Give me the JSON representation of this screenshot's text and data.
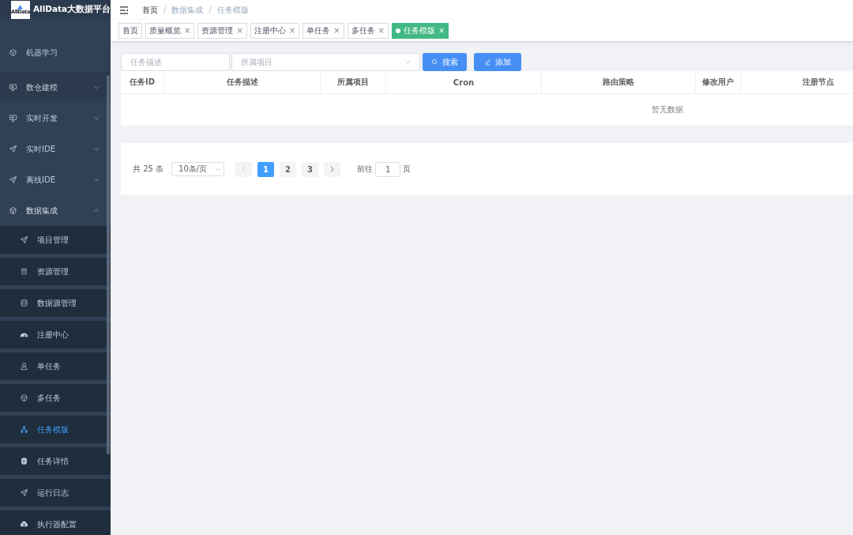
{
  "app": {
    "title": "AllData大数据平台",
    "logo": "AllData"
  },
  "sidebar": {
    "items": [
      {
        "label": "机器学习",
        "has_arrow": false,
        "expanded": false,
        "selected": false
      },
      {
        "label": "数仓建模",
        "has_arrow": true,
        "expanded": false,
        "selected": false
      },
      {
        "label": "实时开发",
        "has_arrow": true,
        "expanded": false,
        "selected": false
      },
      {
        "label": "实时IDE",
        "has_arrow": true,
        "expanded": false,
        "selected": false
      },
      {
        "label": "离线IDE",
        "has_arrow": true,
        "expanded": false,
        "selected": false
      },
      {
        "label": "数据集成",
        "has_arrow": true,
        "expanded": true,
        "selected": false,
        "children": [
          {
            "label": "项目管理",
            "selected": false
          },
          {
            "label": "资源管理",
            "selected": false
          },
          {
            "label": "数据源管理",
            "selected": false
          },
          {
            "label": "注册中心",
            "selected": false
          },
          {
            "label": "单任务",
            "selected": false
          },
          {
            "label": "多任务",
            "selected": false
          },
          {
            "label": "任务模版",
            "selected": true
          },
          {
            "label": "任务详情",
            "selected": false
          },
          {
            "label": "运行日志",
            "selected": false
          },
          {
            "label": "执行器配置",
            "selected": false
          }
        ]
      }
    ]
  },
  "breadcrumb": [
    "首页",
    "数据集成",
    "任务模版"
  ],
  "breadcrumb_separator": "/",
  "tabs": [
    {
      "label": "首页",
      "closable": false,
      "selected": false
    },
    {
      "label": "质量概览",
      "closable": true,
      "selected": false
    },
    {
      "label": "资源管理",
      "closable": true,
      "selected": false
    },
    {
      "label": "注册中心",
      "closable": true,
      "selected": false
    },
    {
      "label": "单任务",
      "closable": true,
      "selected": false
    },
    {
      "label": "多任务",
      "closable": true,
      "selected": false
    },
    {
      "label": "任务模版",
      "closable": true,
      "selected": true
    }
  ],
  "close_glyph": "×",
  "filters": {
    "description": {
      "placeholder": "任务描述"
    },
    "project": {
      "placeholder": "所属项目"
    }
  },
  "buttons": [
    {
      "label": "搜索"
    },
    {
      "label": "添加"
    }
  ],
  "table": {
    "columns": [
      "任务ID",
      "任务描述",
      "所属项目",
      "Cron",
      "路由策略",
      "修改用户",
      "注册节点"
    ],
    "empty_text": "暂无数据"
  },
  "pagination": {
    "total": "共 25 条",
    "page_size": "10条/页",
    "pages": [
      {
        "label": "1",
        "selected": true
      },
      {
        "label": "2",
        "selected": false
      },
      {
        "label": "3",
        "selected": false
      }
    ],
    "goto_label": "前往",
    "goto_value": "1",
    "goto_suffix": "页"
  }
}
